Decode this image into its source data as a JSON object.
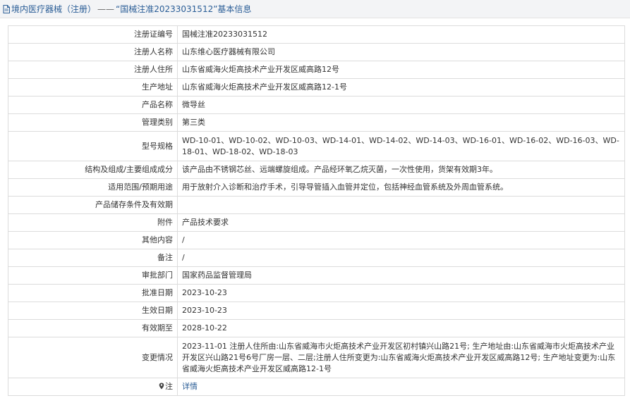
{
  "header": {
    "category": "境内医疗器械（注册）",
    "separator": "——",
    "title": "“国械注准20233031512”基本信息"
  },
  "rows": [
    {
      "label": "注册证编号",
      "value": "国械注准20233031512"
    },
    {
      "label": "注册人名称",
      "value": "山东维心医疗器械有限公司"
    },
    {
      "label": "注册人住所",
      "value": "山东省威海火炬高技术产业开发区威高路12号"
    },
    {
      "label": "生产地址",
      "value": "山东省威海火炬高技术产业开发区威高路12-1号"
    },
    {
      "label": "产品名称",
      "value": "微导丝"
    },
    {
      "label": "管理类别",
      "value": "第三类"
    },
    {
      "label": "型号规格",
      "value": "WD-10-01、WD-10-02、WD-10-03、WD-14-01、WD-14-02、WD-14-03、WD-16-01、WD-16-02、WD-16-03、WD-18-01、WD-18-02、WD-18-03"
    },
    {
      "label": "结构及组成/主要组成成分",
      "value": "该产品由不锈钢芯丝、远端螺旋组成。产品经环氧乙烷灭菌，一次性使用，货架有效期3年。"
    },
    {
      "label": "适用范围/预期用途",
      "value": "用于放射介入诊断和治疗手术，引导导管插入血管并定位，包括神经血管系统及外周血管系统。"
    },
    {
      "label": "产品储存条件及有效期",
      "value": ""
    },
    {
      "label": "附件",
      "value": "产品技术要求"
    },
    {
      "label": "其他内容",
      "value": "/"
    },
    {
      "label": "备注",
      "value": "/"
    },
    {
      "label": "审批部门",
      "value": "国家药品监督管理局"
    },
    {
      "label": "批准日期",
      "value": "2023-10-23"
    },
    {
      "label": "生效日期",
      "value": "2023-10-23"
    },
    {
      "label": "有效期至",
      "value": "2028-10-22"
    },
    {
      "label": "变更情况",
      "value": "2023-11-01 注册人住所由:山东省威海市火炬高技术产业开发区初村镇兴山路21号; 生产地址由:山东省威海市火炬高技术产业开发区兴山路21号6号厂房一层、二层;注册人住所变更为:山东省威海火炬高技术产业开发区威高路12号; 生产地址变更为:山东省威海火炬高技术产业开发区威高路12-1号"
    }
  ],
  "note_row": {
    "label": "注",
    "link": "详情"
  }
}
